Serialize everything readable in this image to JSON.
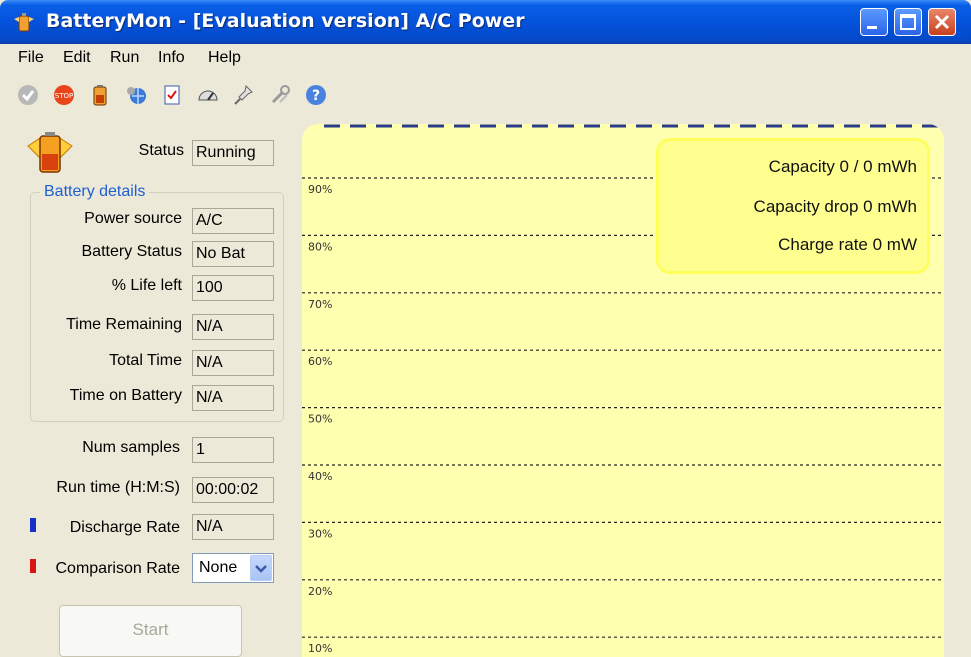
{
  "window": {
    "title": "BatteryMon - [Evaluation version] A/C Power"
  },
  "menu": [
    "File",
    "Edit",
    "Run",
    "Info",
    "Help"
  ],
  "toolbar": {
    "icons": [
      "check-icon",
      "stop-icon",
      "battery-icon",
      "settings-globe-icon",
      "checklist-icon",
      "gauge-icon",
      "pin-icon",
      "tools-icon",
      "help-icon"
    ]
  },
  "status": {
    "label": "Status",
    "value": "Running"
  },
  "battery_details": {
    "title": "Battery details",
    "rows": [
      {
        "label": "Power source",
        "value": "A/C"
      },
      {
        "label": "Battery Status",
        "value": "No Bat"
      },
      {
        "label": "% Life left",
        "value": "100"
      },
      {
        "label": "Time Remaining",
        "value": "N/A"
      },
      {
        "label": "Total Time",
        "value": "N/A"
      },
      {
        "label": "Time on Battery",
        "value": "N/A"
      }
    ]
  },
  "samples": {
    "label": "Num samples",
    "value": "1"
  },
  "runtime": {
    "label": "Run time (H:M:S)",
    "value": "00:00:02"
  },
  "discharge": {
    "label": "Discharge Rate",
    "value": "N/A",
    "color": "#1530c8"
  },
  "comparison": {
    "label": "Comparison Rate",
    "value": "None",
    "color": "#d81414"
  },
  "start_label": "Start",
  "graph": {
    "background": "#ffffb0",
    "gridlines": [
      "90%",
      "80%",
      "70%",
      "60%",
      "50%",
      "40%",
      "30%",
      "20%",
      "10%"
    ],
    "info": {
      "capacity": "Capacity 0 / 0 mWh",
      "capacity_drop": "Capacity drop 0 mWh",
      "charge_rate": "Charge rate 0 mW"
    },
    "line_color": "#2a3a8c"
  }
}
